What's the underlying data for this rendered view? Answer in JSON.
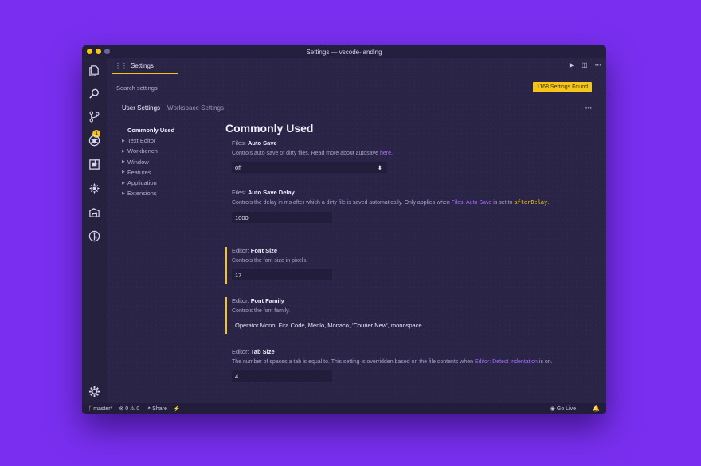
{
  "window": {
    "title": "Settings — vscode-landing"
  },
  "traffic_colors": [
    "#f5c518",
    "#f5c518",
    "#f5c518"
  ],
  "activity_icons": [
    "files-icon",
    "search-icon",
    "source-control-icon",
    "debug-icon",
    "extensions-icon",
    "remote-icon",
    "docker-icon",
    "git-lens-icon",
    "settings-gear-icon"
  ],
  "source_control_badge": "1",
  "tab": {
    "label": "Settings"
  },
  "search": {
    "placeholder": "Search settings",
    "found": "1168 Settings Found"
  },
  "scopes": {
    "user": "User Settings",
    "workspace": "Workspace Settings"
  },
  "toc": {
    "active": "Commonly Used",
    "items": [
      "Text Editor",
      "Workbench",
      "Window",
      "Features",
      "Application",
      "Extensions"
    ]
  },
  "content": {
    "title": "Commonly Used",
    "auto_save": {
      "category": "Files: ",
      "name": "Auto Save",
      "desc": "Controls auto save of dirty files. Read more about autosave ",
      "link": "here",
      "value": "off"
    },
    "auto_save_delay": {
      "category": "Files: ",
      "name": "Auto Save Delay",
      "desc_pre": "Controls the delay in ms after which a dirty file is saved automatically. Only applies when ",
      "desc_link": "Files: Auto Save",
      "desc_mid": " is set to ",
      "desc_code": "afterDelay",
      "desc_post": ".",
      "value": "1000"
    },
    "font_size": {
      "category": "Editor: ",
      "name": "Font Size",
      "desc": "Controls the font size in pixels.",
      "value": "17"
    },
    "font_family": {
      "category": "Editor: ",
      "name": "Font Family",
      "desc": "Controls the font family.",
      "value": "Operator Mono, Fira Code, Menlo, Monaco, 'Courier New', monospace"
    },
    "tab_size": {
      "category": "Editor: ",
      "name": "Tab Size",
      "desc_pre": "The number of spaces a tab is equal to. This setting is overridden based on the file contents when ",
      "desc_link": "Editor: Detect Indentation",
      "desc_post": " is on.",
      "value": "4"
    }
  },
  "statusbar": {
    "branch": "master*",
    "errors": "0",
    "warnings": "0",
    "share": "Share",
    "go_live": "Go Live"
  },
  "colors": {
    "accent": "#f5c518",
    "link": "#a86cff",
    "background": "#7a2ff0"
  }
}
